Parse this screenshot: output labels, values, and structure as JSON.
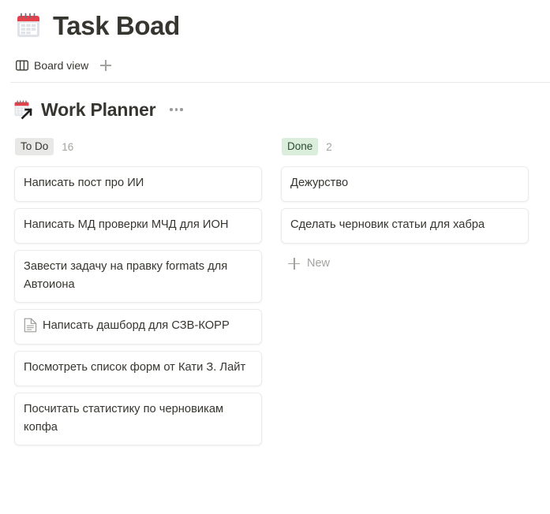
{
  "page": {
    "emoji_name": "calendar-emoji",
    "title": "Task Boad"
  },
  "viewbar": {
    "tabs": [
      {
        "icon": "board-view-icon",
        "label": "Board view"
      }
    ],
    "add_view_icon": "plus-icon"
  },
  "database": {
    "emoji_name": "calendar-link-emoji",
    "title": "Work Planner",
    "more_icon": "ellipsis-icon"
  },
  "board": {
    "columns": [
      {
        "name": "To Do",
        "count": "16",
        "badge_bg": "#e8e8e6",
        "badge_color": "#37352f",
        "show_new": false,
        "new_label": "New",
        "cards": [
          {
            "title": "Написать пост про ИИ",
            "icon": null
          },
          {
            "title": "Написать МД проверки МЧД для ИОН",
            "icon": null
          },
          {
            "title": "Завести задачу на правку formats для Автоиона",
            "icon": null
          },
          {
            "title": "Написать дашборд для СЗВ-КОРР",
            "icon": "page-icon"
          },
          {
            "title": "Посмотреть список форм от Кати З. Лайт",
            "icon": null
          },
          {
            "title": "Посчитать статистику по черновикам копфа",
            "icon": null
          }
        ]
      },
      {
        "name": "Done",
        "count": "2",
        "badge_bg": "#dbeddb",
        "badge_color": "#2d4c33",
        "show_new": true,
        "new_label": "New",
        "cards": [
          {
            "title": "Дежурство",
            "icon": null
          },
          {
            "title": "Сделать черновик статьи для хабра",
            "icon": null
          }
        ]
      }
    ]
  },
  "colors": {
    "text": "#37352f",
    "muted": "#a4a3a0",
    "card_border": "#ecebea",
    "divider": "#e9e9e7",
    "page_bg": "#ffffff"
  }
}
